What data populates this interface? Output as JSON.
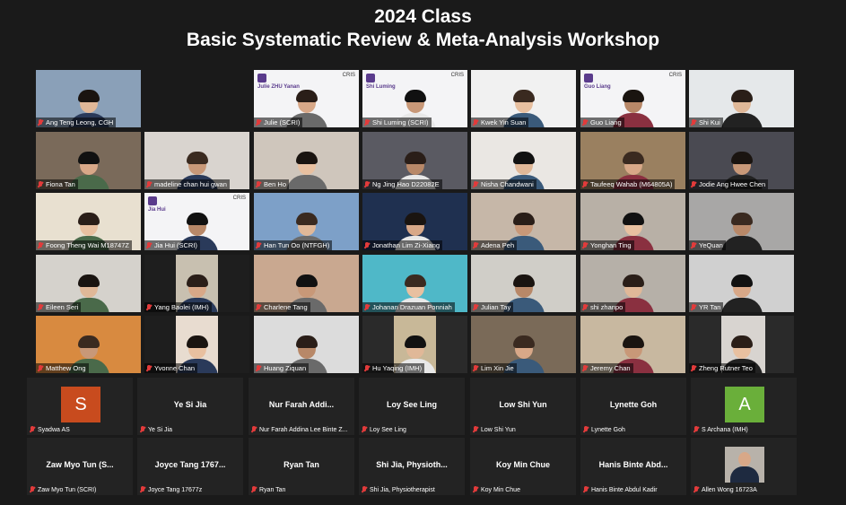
{
  "title": {
    "line1": "2024 Class",
    "line2": "Basic Systematic Review & Meta-Analysis Workshop"
  },
  "video_tiles": [
    {
      "name": "Ang Teng Leong, CGH",
      "bg": "#8aa0b8"
    },
    {
      "name": "Julie (SCRI)",
      "bg": "#f4f4f6",
      "slide": "Julie ZHU Yanan"
    },
    {
      "name": "Shi Luming (SCRI)",
      "bg": "#f4f4f6",
      "slide": "Shi Luming"
    },
    {
      "name": "Kwek Yin Suan",
      "bg": "#f1f1f1"
    },
    {
      "name": "Guo Liang",
      "bg": "#f4f4f6",
      "slide": "Guo Liang"
    },
    {
      "name": "Shi Kui",
      "bg": "#e5e8ea"
    },
    {
      "name": "Fiona Tan",
      "bg": "#7a6a5a"
    },
    {
      "name": "madeline chan hui gwan",
      "bg": "#d9d4cf"
    },
    {
      "name": "Ben Ho",
      "bg": "#cfc6bc"
    },
    {
      "name": "Ng Jing Hao D22082E",
      "bg": "#5a5a62"
    },
    {
      "name": "Nisha Chandwani",
      "bg": "#eae7e3"
    },
    {
      "name": "Taufeeq Wahab (M64805A)",
      "bg": "#9a8060"
    },
    {
      "name": "Jodie Ang Hwee Chen",
      "bg": "#4a4a52"
    },
    {
      "name": "Foong Theng Wai M18747Z",
      "bg": "#e8e0d0"
    },
    {
      "name": "Jia Hui (SCRI)",
      "bg": "#f4f4f6",
      "slide": "Jia Hui"
    },
    {
      "name": "Han Tun Oo (NTFGH)",
      "bg": "#7da0c8"
    },
    {
      "name": "Jonathan Lim Zi-Xiang",
      "bg": "#1f3050"
    },
    {
      "name": "Adena Peh",
      "bg": "#c6b7a8"
    },
    {
      "name": "Yonghan Ting",
      "bg": "#b8b0a6"
    },
    {
      "name": "YeQuan",
      "bg": "#a8a7a6"
    },
    {
      "name": "Eileen Seri",
      "bg": "#d5d2cc"
    },
    {
      "name": "Yang Baolei (IMH)",
      "bg": "#c8c0b0"
    },
    {
      "name": "Charlene Tang",
      "bg": "#c9a890"
    },
    {
      "name": "Johanan Drazuan Ponniah",
      "bg": "#4fb8c8"
    },
    {
      "name": "Julian Tay",
      "bg": "#d0cec8"
    },
    {
      "name": "shi zhanpo",
      "bg": "#b6b0a8"
    },
    {
      "name": "YR Tan",
      "bg": "#d0d0d0"
    },
    {
      "name": "Matthew Ong",
      "bg": "#d88a40"
    },
    {
      "name": "Yvonne Chan",
      "bg": "#e8dcd0"
    },
    {
      "name": "Huang Ziquan",
      "bg": "#dcdcdc"
    },
    {
      "name": "Hu Yaqing (IMH)",
      "bg": "#c8b898"
    },
    {
      "name": "Lim Xin Jie",
      "bg": "#7a6a58"
    },
    {
      "name": "Jeremy Chan",
      "bg": "#c8b8a0"
    },
    {
      "name": "Zheng Rutner Teo",
      "bg": "#d8d4d0"
    }
  ],
  "audio_tiles": [
    {
      "title": "",
      "name": "Syadwa AS",
      "avatar": "S",
      "avatar_color": "#c84b1e"
    },
    {
      "title": "Ye Si Jia",
      "name": "Ye Si Jia"
    },
    {
      "title": "Nur Farah Addi...",
      "name": "Nur Farah Addina Lee Binte Z..."
    },
    {
      "title": "Loy See Ling",
      "name": "Loy See Ling"
    },
    {
      "title": "Low Shi Yun",
      "name": "Low Shi Yun"
    },
    {
      "title": "Lynette Goh",
      "name": "Lynette Goh"
    },
    {
      "title": "",
      "name": "S Archana (IMH)",
      "avatar": "A",
      "avatar_color": "#6aaf3a"
    },
    {
      "title": "Zaw Myo Tun (S...",
      "name": "Zaw Myo Tun (SCRI)"
    },
    {
      "title": "Joyce Tang 1767...",
      "name": "Joyce Tang 17677z"
    },
    {
      "title": "Ryan Tan",
      "name": "Ryan Tan"
    },
    {
      "title": "Shi Jia,  Physioth...",
      "name": "Shi Jia, Physiotherapist"
    },
    {
      "title": "Koy Min Chue",
      "name": "Koy Min Chue"
    },
    {
      "title": "Hanis Binte Abd...",
      "name": "Hanis Binte Abdul Kadir"
    },
    {
      "title": "",
      "name": "Allen Wong 16723A",
      "photo": true
    }
  ],
  "slide_label": "CRIS",
  "colors": {
    "background": "#1a1a1a",
    "tile": "#232323",
    "mic_muted": "#e23b3b"
  }
}
